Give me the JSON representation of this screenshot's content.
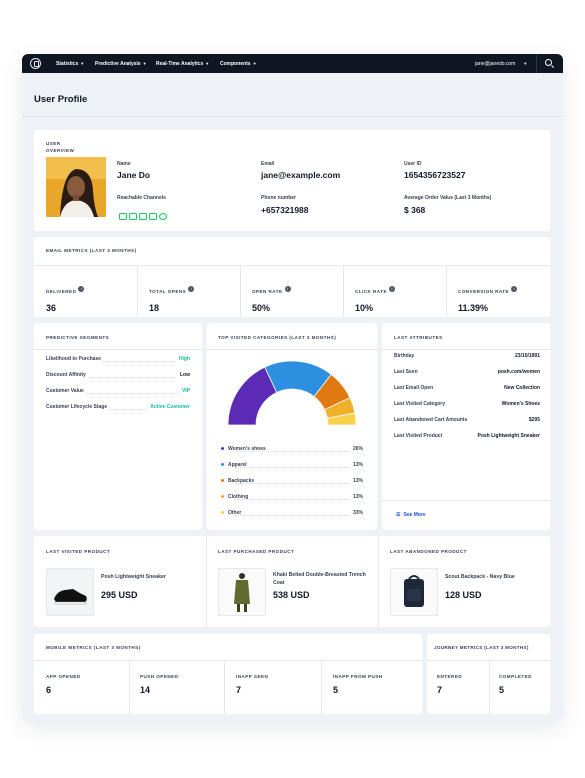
{
  "nav": {
    "menus": [
      "Statistics",
      "Predictive Analysis",
      "Real-Time Analytics",
      "Components"
    ],
    "user_email": "jane@janedo.com"
  },
  "page": {
    "title": "User Profile"
  },
  "overview": {
    "section_label": "USER OVERVIEW",
    "name_label": "Name",
    "name": "Jane Do",
    "email_label": "Email",
    "email": "jane@example.com",
    "userid_label": "User ID",
    "userid": "1654356723527",
    "channels_label": "Reachable Channels",
    "channels": [
      "email-channel-icon",
      "sms-channel-icon",
      "push-channel-icon",
      "chat-channel-icon",
      "whatsapp-channel-icon"
    ],
    "phone_label": "Phone number",
    "phone": "+657321988",
    "aov_label": "Average Order Value (Last 3 Months)",
    "aov": "$ 368"
  },
  "email_metrics": {
    "title": "EMAIL METRICS (LAST 3 MONTHS)",
    "items": [
      {
        "label": "DELIVERED",
        "value": "36"
      },
      {
        "label": "TOTAL OPENS",
        "value": "18"
      },
      {
        "label": "OPEN RATE",
        "value": "50%"
      },
      {
        "label": "CLICK RATE",
        "value": "10%"
      },
      {
        "label": "CONVERSION RATE",
        "value": "11.39%"
      }
    ]
  },
  "segments": {
    "title": "PREDICTIVE SEGMENTS",
    "rows": [
      {
        "label": "Likelihood to Purchase",
        "value": "High",
        "color": "#14b8a6"
      },
      {
        "label": "Discount Affinity",
        "value": "Low",
        "color": "#111827"
      },
      {
        "label": "Customer Value",
        "value": "VIP",
        "color": "#14b8a6"
      },
      {
        "label": "Customer Lifecycle Stage",
        "value": "Active Customer",
        "color": "#14b8a6"
      }
    ]
  },
  "chart_data": {
    "type": "pie",
    "title": "TOP VISITED CATEGORIES (LAST 3 MONTHS)",
    "categories": [
      "Women's shoes",
      "Apparel",
      "Backpacks",
      "Clothing",
      "Other"
    ],
    "values": [
      26,
      13,
      13,
      13,
      33
    ],
    "labels": [
      "26%",
      "13%",
      "13%",
      "13%",
      "33%"
    ],
    "colors": [
      "#5b2bb5",
      "#2d8fe0",
      "#e07a10",
      "#f0b02a",
      "#f7d14a"
    ],
    "arc_shares": [
      0.36,
      0.35,
      0.15,
      0.08,
      0.06
    ],
    "style": "semi-donut",
    "legend_position": "bottom"
  },
  "attributes": {
    "title": "LAST ATTRIBUTES",
    "rows": [
      {
        "label": "Birthday",
        "value": "23/10/1991"
      },
      {
        "label": "Last Seen",
        "value": "posh.com/women"
      },
      {
        "label": "Last Email Open",
        "value": "New Collection"
      },
      {
        "label": "Last Visited Category",
        "value": "Women's Shoes"
      },
      {
        "label": "Last Abandoned Cart Amounts",
        "value": "$295"
      },
      {
        "label": "Last Visited Product",
        "value": "Posh Lightweight Sneaker"
      }
    ],
    "see_more": "See More"
  },
  "products": [
    {
      "title": "LAST VISITED PRODUCT",
      "name": "Posh Lightweight Sneaker",
      "price": "295 USD",
      "icon": "sneaker-image"
    },
    {
      "title": "LAST PURCHASED PRODUCT",
      "name": "Khaki Belted Double-Breasted Trench Coat",
      "price": "538 USD",
      "icon": "trench-coat-image"
    },
    {
      "title": "LAST ABANDONED PRODUCT",
      "name": "Scout Backpack - Navy Blue",
      "price": "128 USD",
      "icon": "backpack-image"
    }
  ],
  "mobile_metrics": {
    "title": "MOBILE METRICS (LAST 3 MONTHS)",
    "items": [
      {
        "label": "APP OPENED",
        "value": "6"
      },
      {
        "label": "PUSH OPENED",
        "value": "14"
      },
      {
        "label": "INAPP SEEN",
        "value": "7"
      },
      {
        "label": "INAPP FROM PUSH",
        "value": "5"
      }
    ]
  },
  "journey_metrics": {
    "title": "JOURNEY METRICS (LAST 3 MONTHS)",
    "items": [
      {
        "label": "ENTERED",
        "value": "7"
      },
      {
        "label": "COMPLETED",
        "value": "5"
      }
    ]
  }
}
